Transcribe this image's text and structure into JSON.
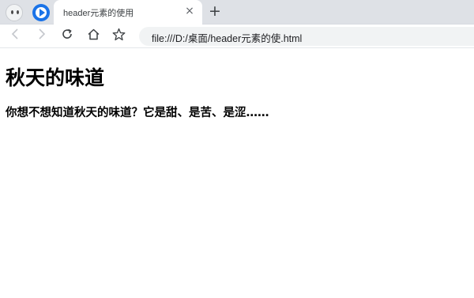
{
  "browser": {
    "tab": {
      "title": "header元素的使用",
      "close_label": "×"
    },
    "new_tab_label": "+",
    "address": "file:///D:/桌面/header元素的使.html",
    "icons": {
      "profile": "profile-avatar-icon",
      "tab_favicon": "play-circle-icon",
      "back": "arrow-left-icon",
      "forward": "arrow-right-icon",
      "reload": "reload-icon",
      "home": "home-icon",
      "favorite": "star-icon"
    },
    "colors": {
      "tab_strip": "#dee1e6",
      "accent": "#1a73e8",
      "address_bg": "#f1f3f4"
    }
  },
  "page": {
    "heading": "秋天的味道",
    "subheading": "你想不想知道秋天的味道？它是甜、是苦、是涩……"
  }
}
